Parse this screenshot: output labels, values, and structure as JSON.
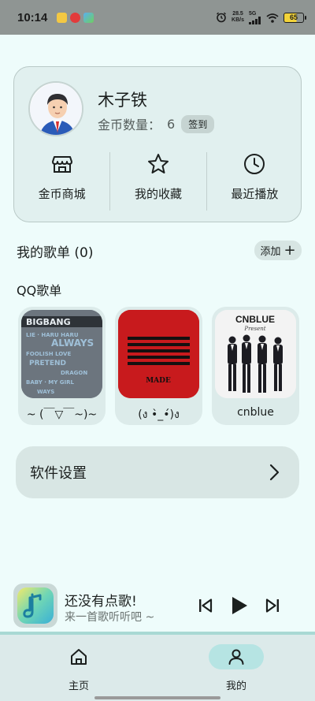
{
  "status_bar": {
    "time": "10:14",
    "speed_value": "28.5",
    "speed_unit": "KB/s",
    "network": "5G",
    "battery": "65"
  },
  "profile": {
    "name": "木子铁",
    "coin_label": "金币数量：",
    "coin_value": "6",
    "signin_label": "签到"
  },
  "quick_actions": [
    {
      "label": "金币商城",
      "icon": "store-icon"
    },
    {
      "label": "我的收藏",
      "icon": "star-icon"
    },
    {
      "label": "最近播放",
      "icon": "clock-icon"
    }
  ],
  "playlists_section": {
    "title": "我的歌单 (0)",
    "add_label": "添加"
  },
  "qq_section": {
    "title": "QQ歌单",
    "items": [
      {
        "name": "~ (￣▽￣~)~",
        "cover_text": "BIGBANG"
      },
      {
        "name": "(ง •̀_•́)ง",
        "cover_text": "MADE"
      },
      {
        "name": "cnblue",
        "cover_text": "CNBLUE"
      }
    ]
  },
  "settings": {
    "label": "软件设置"
  },
  "mini_player": {
    "title": "还没有点歌!",
    "subtitle": "来一首歌听听吧 ~"
  },
  "bottom_nav": [
    {
      "label": "主页",
      "icon": "home-icon",
      "active": false
    },
    {
      "label": "我的",
      "icon": "person-icon",
      "active": true
    }
  ],
  "colors": {
    "background": "#eefcfb",
    "card": "#e1f0ef",
    "active_nav": "#b6e4e3",
    "status_bar": "#8f9593"
  }
}
